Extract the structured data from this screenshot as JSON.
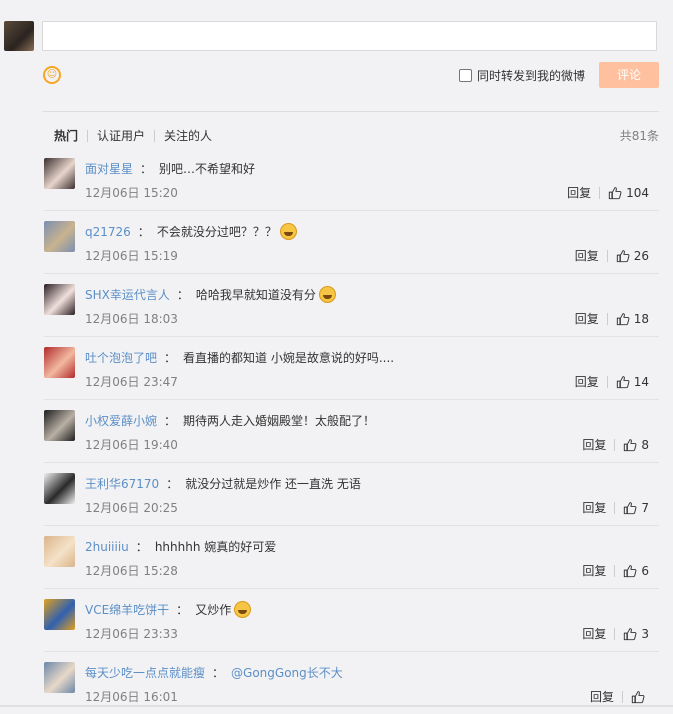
{
  "composer": {
    "repost_label": "同时转发到我的微博",
    "submit_label": "评论",
    "emoji_icon": "smiley-icon"
  },
  "tabs": [
    "热门",
    "认证用户",
    "关注的人"
  ],
  "total": "共81条",
  "reply_label": "回复",
  "comments": [
    {
      "user": "面对星星",
      "text": "别吧…不希望和好",
      "mention": "",
      "emoji": false,
      "time": "12月06日 15:20",
      "likes": "104",
      "avatar_colors": [
        "#3a2e2e",
        "#e8d5cc"
      ]
    },
    {
      "user": "q21726",
      "text": "不会就没分过吧？？？",
      "mention": "",
      "emoji": true,
      "time": "12月06日 15:19",
      "likes": "26",
      "avatar_colors": [
        "#7a8fb0",
        "#c9b38f"
      ]
    },
    {
      "user": "SHX幸运代言人",
      "text": "哈哈我早就知道没有分",
      "mention": "",
      "emoji": true,
      "time": "12月06日 18:03",
      "likes": "18",
      "avatar_colors": [
        "#2a1e22",
        "#f0e0dc"
      ]
    },
    {
      "user": "吐个泡泡了吧",
      "text": "看直播的都知道 小婉是故意说的好吗....",
      "mention": "",
      "emoji": false,
      "time": "12月06日 23:47",
      "likes": "14",
      "avatar_colors": [
        "#b02a2a",
        "#f2b8a0"
      ]
    },
    {
      "user": "小权爱薛小婉",
      "text": "期待两人走入婚姻殿堂！太般配了！",
      "mention": "",
      "emoji": false,
      "time": "12月06日 19:40",
      "likes": "8",
      "avatar_colors": [
        "#1e1e1e",
        "#b8b0a4"
      ]
    },
    {
      "user": "王利华67170",
      "text": "就没分过就是炒作 还一直洗 无语",
      "mention": "",
      "emoji": false,
      "time": "12月06日 20:25",
      "likes": "7",
      "avatar_colors": [
        "#f2f2f2",
        "#2a2a2a"
      ]
    },
    {
      "user": "2huiiiiu",
      "text": "hhhhhh 婉真的好可爱",
      "mention": "",
      "emoji": false,
      "time": "12月06日 15:28",
      "likes": "6",
      "avatar_colors": [
        "#d9b48a",
        "#f5e2c8"
      ]
    },
    {
      "user": "VCE绵羊吃饼干",
      "text": "又炒作",
      "mention": "",
      "emoji": true,
      "time": "12月06日 23:33",
      "likes": "3",
      "avatar_colors": [
        "#e0a020",
        "#3060b0"
      ]
    },
    {
      "user": "每天少吃一点点就能瘦",
      "text": "",
      "mention": "@GongGong长不大",
      "emoji": false,
      "time": "12月06日 16:01",
      "likes": "",
      "avatar_colors": [
        "#6a88a8",
        "#e8d8c8"
      ]
    }
  ]
}
